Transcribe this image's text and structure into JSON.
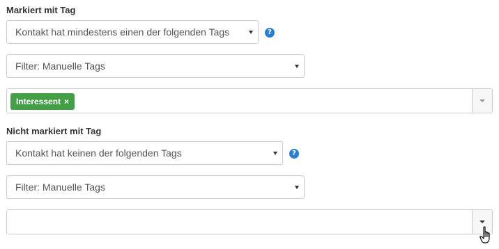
{
  "tagged": {
    "label": "Markiert mit Tag",
    "condition_select": "Kontakt hat mindestens einen der folgenden Tags",
    "help_icon_text": "?",
    "filter_select": "Filter: Manuelle Tags",
    "tags": [
      {
        "label": "Interessent",
        "remove_glyph": "×",
        "color": "#43a047"
      }
    ]
  },
  "not_tagged": {
    "label": "Nicht markiert mit Tag",
    "condition_select": "Kontakt hat keinen der folgenden Tags",
    "help_icon_text": "?",
    "filter_select": "Filter: Manuelle Tags",
    "tags": []
  },
  "colors": {
    "help_icon": "#2a7fd4",
    "tag_green": "#43a047",
    "border": "#cccccc"
  },
  "icons": {
    "help": "help-circle-icon",
    "caret": "chevron-down-icon",
    "remove": "close-icon",
    "cursor": "hand-pointer-icon"
  }
}
